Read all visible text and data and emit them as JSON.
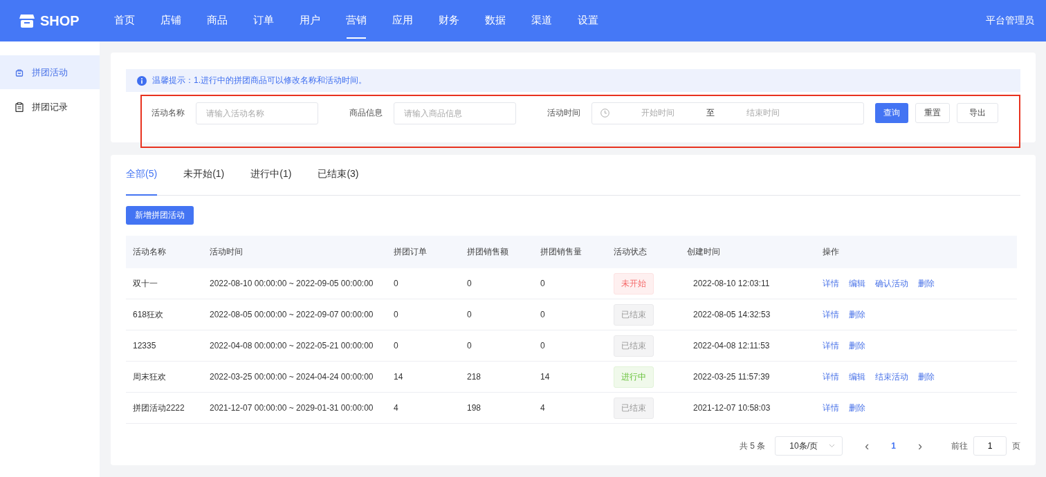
{
  "header": {
    "logo": "SHOP",
    "nav": [
      {
        "label": "首页",
        "selected": false
      },
      {
        "label": "店铺",
        "selected": false
      },
      {
        "label": "商品",
        "selected": false
      },
      {
        "label": "订单",
        "selected": false
      },
      {
        "label": "用户",
        "selected": false
      },
      {
        "label": "营销",
        "selected": true
      },
      {
        "label": "应用",
        "selected": false
      },
      {
        "label": "财务",
        "selected": false
      },
      {
        "label": "数据",
        "selected": false
      },
      {
        "label": "渠道",
        "selected": false
      },
      {
        "label": "设置",
        "selected": false
      }
    ],
    "user": "平台管理员"
  },
  "sidebar": {
    "items": [
      {
        "label": "拼团活动",
        "kind": "bag",
        "selected": true
      },
      {
        "label": "拼团记录",
        "kind": "clipboard",
        "selected": false
      }
    ]
  },
  "notice": "温馨提示：1.进行中的拼团商品可以修改名称和活动时间。",
  "filters": {
    "name": {
      "label": "活动名称",
      "placeholder": "请输入活动名称"
    },
    "goods": {
      "label": "商品信息",
      "placeholder": "请输入商品信息"
    },
    "time": {
      "label": "活动时间",
      "start_placeholder": "开始时间",
      "separator": "至",
      "end_placeholder": "结束时间"
    },
    "buttons": [
      {
        "label": "查询",
        "kind": "primary"
      },
      {
        "label": "重置",
        "kind": "default"
      },
      {
        "label": "导出",
        "kind": "default"
      }
    ]
  },
  "tabs": [
    {
      "label": "全部(5)",
      "selected": true
    },
    {
      "label": "未开始(1)",
      "selected": false
    },
    {
      "label": "进行中(1)",
      "selected": false
    },
    {
      "label": "已结束(3)",
      "selected": false
    }
  ],
  "add_button": "新增拼团活动",
  "table": {
    "columns": [
      "活动名称",
      "活动时间",
      "拼团订单",
      "拼团销售额",
      "拼团销售量",
      "活动状态",
      "创建时间",
      "操作"
    ],
    "rows": [
      {
        "name": "双十一",
        "time": "2022-08-10 00:00:00 ~ 2022-09-05 00:00:00",
        "orders": "0",
        "sales": "0",
        "quantity": "0",
        "status": {
          "label": "未开始",
          "kind": "pending"
        },
        "created": "2022-08-10 12:03:11",
        "actions": [
          "详情",
          "编辑",
          "确认活动",
          "删除"
        ]
      },
      {
        "name": "618狂欢",
        "time": "2022-08-05 00:00:00 ~ 2022-09-07 00:00:00",
        "orders": "0",
        "sales": "0",
        "quantity": "0",
        "status": {
          "label": "已结束",
          "kind": "ended"
        },
        "created": "2022-08-05 14:32:53",
        "actions": [
          "详情",
          "删除"
        ]
      },
      {
        "name": "12335",
        "time": "2022-04-08 00:00:00 ~ 2022-05-21 00:00:00",
        "orders": "0",
        "sales": "0",
        "quantity": "0",
        "status": {
          "label": "已结束",
          "kind": "ended"
        },
        "created": "2022-04-08 12:11:53",
        "actions": [
          "详情",
          "删除"
        ]
      },
      {
        "name": "周末狂欢",
        "time": "2022-03-25 00:00:00 ~ 2024-04-24 00:00:00",
        "orders": "14",
        "sales": "218",
        "quantity": "14",
        "status": {
          "label": "进行中",
          "kind": "active"
        },
        "created": "2022-03-25 11:57:39",
        "actions": [
          "详情",
          "编辑",
          "结束活动",
          "删除"
        ]
      },
      {
        "name": "拼团活动2222",
        "time": "2021-12-07 00:00:00 ~ 2029-01-31 00:00:00",
        "orders": "4",
        "sales": "198",
        "quantity": "4",
        "status": {
          "label": "已结束",
          "kind": "ended"
        },
        "created": "2021-12-07 10:58:03",
        "actions": [
          "详情",
          "删除"
        ]
      }
    ]
  },
  "pagination": {
    "total": "共 5 条",
    "page_size": "10条/页",
    "prev": "‹",
    "pages": [
      {
        "label": "1",
        "selected": true
      }
    ],
    "next": "›",
    "goto_label": "前往",
    "goto_value": "1",
    "goto_suffix": "页"
  }
}
